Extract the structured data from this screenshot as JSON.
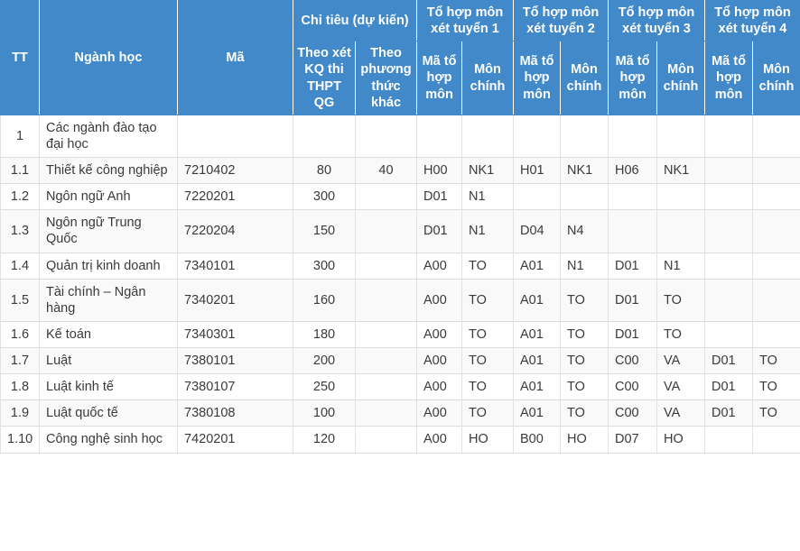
{
  "table": {
    "header": {
      "tt": "TT",
      "nganh_hoc": "Ngành học",
      "ma": "Mã",
      "chi_tieu": "Chỉ tiêu (dự kiến)",
      "chi_tieu_sub_1": "Theo xét KQ thi THPT QG",
      "chi_tieu_sub_2": "Theo phương thức khác",
      "to_hop_1": "Tổ hợp môn xét tuyển 1",
      "to_hop_2": "Tổ hợp môn xét tuyển 2",
      "to_hop_3": "Tổ hợp môn xét tuyển 3",
      "to_hop_4": "Tổ hợp môn xét tuyển 4",
      "ma_to_hop_mon": "Mã tổ hợp môn",
      "mon_chinh": "Môn chính"
    },
    "rows": [
      {
        "tt": "1",
        "nganh_hoc": "Các ngành đào tạo đại học",
        "ma": "",
        "ct_thpt": "",
        "ct_khac": "",
        "th1_ma": "",
        "th1_mon": "",
        "th2_ma": "",
        "th2_mon": "",
        "th3_ma": "",
        "th3_mon": "",
        "th4_ma": "",
        "th4_mon": ""
      },
      {
        "tt": "1.1",
        "nganh_hoc": "Thiết kế công nghiệp",
        "ma": "7210402",
        "ct_thpt": "80",
        "ct_khac": "40",
        "th1_ma": "H00",
        "th1_mon": "NK1",
        "th2_ma": "H01",
        "th2_mon": "NK1",
        "th3_ma": "H06",
        "th3_mon": "NK1",
        "th4_ma": "",
        "th4_mon": ""
      },
      {
        "tt": "1.2",
        "nganh_hoc": "Ngôn ngữ Anh",
        "ma": "7220201",
        "ct_thpt": "300",
        "ct_khac": "",
        "th1_ma": "D01",
        "th1_mon": "N1",
        "th2_ma": "",
        "th2_mon": "",
        "th3_ma": "",
        "th3_mon": "",
        "th4_ma": "",
        "th4_mon": ""
      },
      {
        "tt": "1.3",
        "nganh_hoc": "Ngôn ngữ Trung Quốc",
        "ma": "7220204",
        "ct_thpt": "150",
        "ct_khac": "",
        "th1_ma": "D01",
        "th1_mon": "N1",
        "th2_ma": "D04",
        "th2_mon": "N4",
        "th3_ma": "",
        "th3_mon": "",
        "th4_ma": "",
        "th4_mon": ""
      },
      {
        "tt": "1.4",
        "nganh_hoc": "Quản trị kinh doanh",
        "ma": "7340101",
        "ct_thpt": "300",
        "ct_khac": "",
        "th1_ma": "A00",
        "th1_mon": "TO",
        "th2_ma": "A01",
        "th2_mon": "N1",
        "th3_ma": "D01",
        "th3_mon": "N1",
        "th4_ma": "",
        "th4_mon": ""
      },
      {
        "tt": "1.5",
        "nganh_hoc": "Tài chính – Ngân hàng",
        "ma": "7340201",
        "ct_thpt": "160",
        "ct_khac": "",
        "th1_ma": "A00",
        "th1_mon": "TO",
        "th2_ma": "A01",
        "th2_mon": "TO",
        "th3_ma": "D01",
        "th3_mon": "TO",
        "th4_ma": "",
        "th4_mon": ""
      },
      {
        "tt": "1.6",
        "nganh_hoc": "Kế toán",
        "ma": "7340301",
        "ct_thpt": "180",
        "ct_khac": "",
        "th1_ma": "A00",
        "th1_mon": "TO",
        "th2_ma": "A01",
        "th2_mon": "TO",
        "th3_ma": "D01",
        "th3_mon": "TO",
        "th4_ma": "",
        "th4_mon": ""
      },
      {
        "tt": "1.7",
        "nganh_hoc": "Luật",
        "ma": "7380101",
        "ct_thpt": "200",
        "ct_khac": "",
        "th1_ma": "A00",
        "th1_mon": "TO",
        "th2_ma": "A01",
        "th2_mon": "TO",
        "th3_ma": "C00",
        "th3_mon": "VA",
        "th4_ma": "D01",
        "th4_mon": "TO"
      },
      {
        "tt": "1.8",
        "nganh_hoc": "Luật kinh tế",
        "ma": "7380107",
        "ct_thpt": "250",
        "ct_khac": "",
        "th1_ma": "A00",
        "th1_mon": "TO",
        "th2_ma": "A01",
        "th2_mon": "TO",
        "th3_ma": "C00",
        "th3_mon": "VA",
        "th4_ma": "D01",
        "th4_mon": "TO"
      },
      {
        "tt": "1.9",
        "nganh_hoc": "Luật quốc tế",
        "ma": "7380108",
        "ct_thpt": "100",
        "ct_khac": "",
        "th1_ma": "A00",
        "th1_mon": "TO",
        "th2_ma": "A01",
        "th2_mon": "TO",
        "th3_ma": "C00",
        "th3_mon": "VA",
        "th4_ma": "D01",
        "th4_mon": "TO"
      },
      {
        "tt": "1.10",
        "nganh_hoc": "Công nghệ sinh học",
        "ma": "7420201",
        "ct_thpt": "120",
        "ct_khac": "",
        "th1_ma": "A00",
        "th1_mon": "HO",
        "th2_ma": "B00",
        "th2_mon": "HO",
        "th3_ma": "D07",
        "th3_mon": "HO",
        "th4_ma": "",
        "th4_mon": ""
      }
    ]
  },
  "colors": {
    "header_bg": "#4189c9",
    "header_text": "#ffffff",
    "row_alt_bg": "#f9f9f9",
    "grid_line": "#dcdcdc",
    "body_text": "#3a3a3a"
  }
}
